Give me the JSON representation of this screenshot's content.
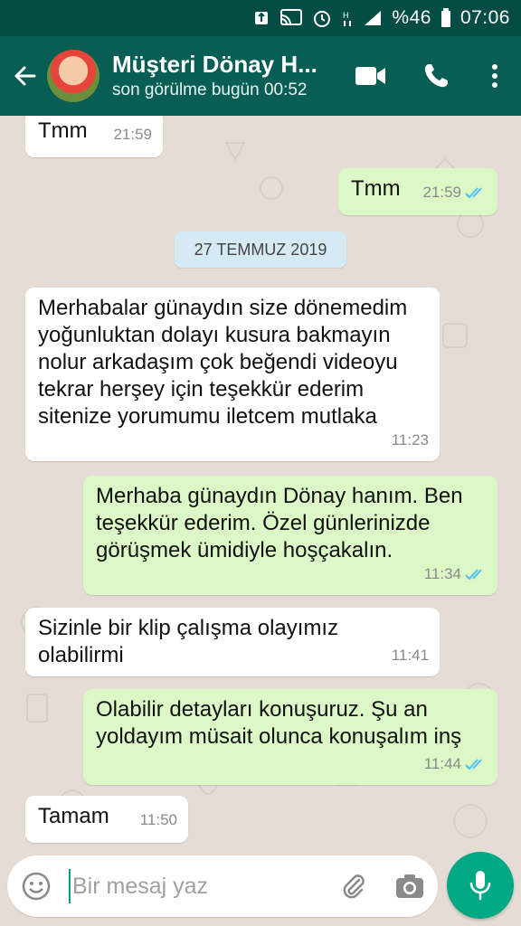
{
  "status_bar": {
    "battery_percent": "%46",
    "time": "07:06"
  },
  "header": {
    "contact_name": "Müşteri Dönay H...",
    "last_seen": "son görülme bugün 00:52"
  },
  "date_divider": "27 TEMMUZ 2019",
  "messages": [
    {
      "direction": "in",
      "text": "Tmm",
      "time": "21:59"
    },
    {
      "direction": "out",
      "text": "Tmm",
      "time": "21:59",
      "read": true
    },
    {
      "direction": "in",
      "text": "Merhabalar günaydın size dönemedim yoğunluktan dolayı kusura bakmayın nolur arkadaşım çok beğendi videoyu tekrar herşey için teşekkür ederim sitenize yorumumu iletcem mutlaka",
      "time": "11:23"
    },
    {
      "direction": "out",
      "text": "Merhaba günaydın Dönay hanım. Ben teşekkür ederim. Özel günlerinizde görüşmek ümidiyle hoşçakalın.",
      "time": "11:34",
      "read": true
    },
    {
      "direction": "in",
      "text": "Sizinle bir klip çalışma olayımız olabilirmi",
      "time": "11:41"
    },
    {
      "direction": "out",
      "text": "Olabilir detayları konuşuruz. Şu an yoldayım müsait olunca konuşalım inş",
      "time": "11:44",
      "read": true
    },
    {
      "direction": "in",
      "text": "Tamam",
      "time": "11:50"
    }
  ],
  "composer": {
    "placeholder": "Bir mesaj yaz",
    "value": ""
  },
  "colors": {
    "header": "#075e54",
    "status_bar": "#054d44",
    "outgoing_bubble": "#dcf8c6",
    "incoming_bubble": "#ffffff",
    "read_ticks": "#4fc3f7",
    "mic_button": "#00a884"
  },
  "icons": [
    "back-arrow-icon",
    "video-call-icon",
    "phone-icon",
    "more-vert-icon",
    "emoji-icon",
    "attach-icon",
    "camera-icon",
    "mic-icon"
  ]
}
